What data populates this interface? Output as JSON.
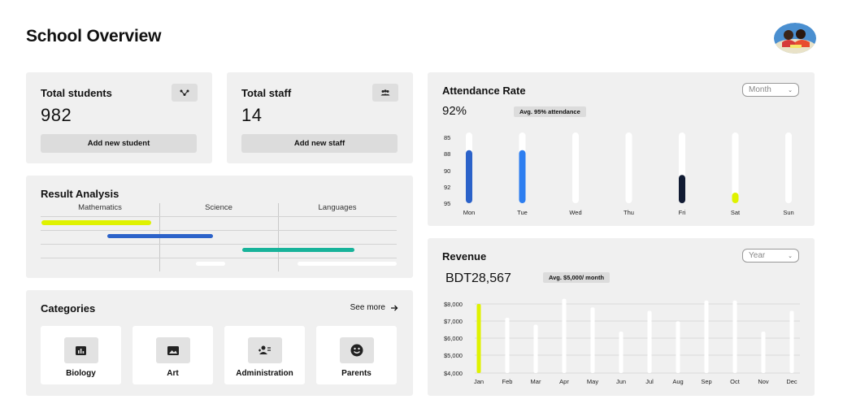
{
  "header": {
    "title": "School Overview"
  },
  "stats": {
    "students": {
      "title": "Total students",
      "value": "982",
      "button": "Add new student",
      "icon": "network-icon"
    },
    "staff": {
      "title": "Total staff",
      "value": "14",
      "button": "Add new staff",
      "icon": "group-icon"
    }
  },
  "result_analysis": {
    "title": "Result Analysis",
    "columns": [
      "Mathematics",
      "Science",
      "Languages"
    ]
  },
  "categories": {
    "title": "Categories",
    "see_more": "See more",
    "items": [
      {
        "label": "Biology",
        "icon": "bar-chart-icon"
      },
      {
        "label": "Art",
        "icon": "image-icon"
      },
      {
        "label": "Administration",
        "icon": "admin-users-icon"
      },
      {
        "label": "Parents",
        "icon": "smiley-icon"
      }
    ]
  },
  "attendance": {
    "title": "Attendance Rate",
    "value": "92%",
    "badge": "Avg. 95% attendance",
    "dropdown": "Month"
  },
  "revenue": {
    "title": "Revenue",
    "value": "BDT28,567",
    "badge": "Avg. $5,000/ month",
    "dropdown": "Year"
  },
  "colors": {
    "card_bg": "#f0f0f0",
    "blue": "#2b62c9",
    "bright_blue": "#2d7ef0",
    "navy": "#111b33",
    "yellow": "#dff200",
    "teal": "#17b39a"
  },
  "chart_data": [
    {
      "type": "bar",
      "title": "Attendance Rate",
      "categories": [
        "Mon",
        "Tue",
        "Wed",
        "Thu",
        "Fri",
        "Sat",
        "Sun"
      ],
      "y_tick_labels": [
        "85",
        "88",
        "90",
        "92",
        "95"
      ],
      "values": [
        87.5,
        87.5,
        0,
        0,
        91.0,
        93.5,
        0
      ],
      "bar_colors": [
        "#2b62c9",
        "#2d7ef0",
        "#ffffff",
        "#ffffff",
        "#111b33",
        "#dff200",
        "#ffffff"
      ]
    },
    {
      "type": "bar",
      "title": "Revenue",
      "categories": [
        "Jan",
        "Feb",
        "Mar",
        "Apr",
        "May",
        "Jun",
        "Jul",
        "Aug",
        "Sep",
        "Oct",
        "Nov",
        "Dec"
      ],
      "y_tick_labels": [
        "$8,000",
        "$7,000",
        "$6,000",
        "$5,000",
        "$4,000"
      ],
      "ylim": [
        4000,
        8000
      ],
      "values": [
        8000,
        7200,
        6800,
        8300,
        7800,
        6400,
        7600,
        7000,
        8200,
        8200,
        6400,
        7600
      ],
      "highlight_index": 0
    }
  ]
}
